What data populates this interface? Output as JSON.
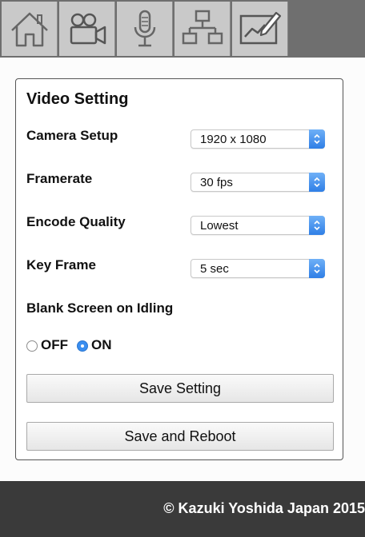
{
  "nav": {
    "items": [
      {
        "icon": "home-icon"
      },
      {
        "icon": "video-camera-icon"
      },
      {
        "icon": "microphone-icon"
      },
      {
        "icon": "network-icon"
      },
      {
        "icon": "chart-edit-icon"
      }
    ]
  },
  "card": {
    "title": "Video Setting",
    "camera_setup": {
      "label": "Camera Setup",
      "value": "1920 x 1080"
    },
    "framerate": {
      "label": "Framerate",
      "value": "30 fps"
    },
    "encode_quality": {
      "label": "Encode Quality",
      "value": "Lowest"
    },
    "key_frame": {
      "label": "Key Frame",
      "value": "5 sec"
    },
    "blank_screen": {
      "label": "Blank Screen on Idling",
      "off_label": "OFF",
      "on_label": "ON",
      "selected": "ON"
    },
    "save_label": "Save Setting",
    "reboot_label": "Save and Reboot"
  },
  "colors": {
    "accent": "#3a8ef0",
    "topbar": "#6f6f6f",
    "footer": "#3a3a3a"
  },
  "footer": {
    "text": "© Kazuki Yoshida Japan 2015"
  }
}
